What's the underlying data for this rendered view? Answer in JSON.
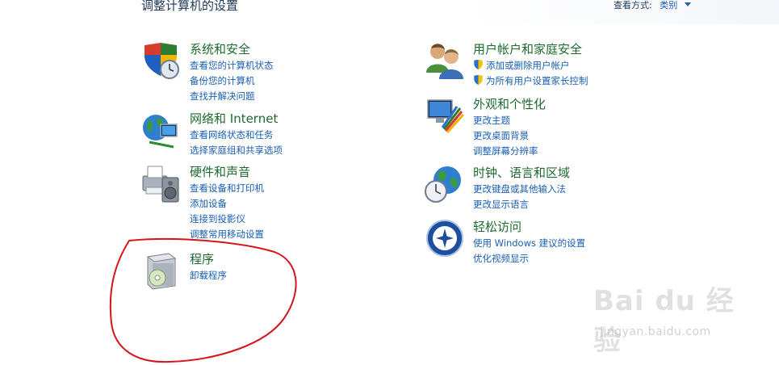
{
  "page": {
    "title": "调整计算机的设置",
    "view_by_label": "查看方式:",
    "view_by_value": "类别"
  },
  "categories": {
    "system": {
      "title": "系统和安全",
      "icon": "shield-clock-icon",
      "links": [
        "查看您的计算机状态",
        "备份您的计算机",
        "查找并解决问题"
      ]
    },
    "network": {
      "title": "网络和 Internet",
      "icon": "network-globe-icon",
      "links": [
        "查看网络状态和任务",
        "选择家庭组和共享选项"
      ]
    },
    "hardware": {
      "title": "硬件和声音",
      "icon": "printer-speaker-icon",
      "links": [
        "查看设备和打印机",
        "添加设备",
        "连接到投影仪",
        "调整常用移动设置"
      ]
    },
    "programs": {
      "title": "程序",
      "icon": "program-box-icon",
      "links": [
        "卸载程序"
      ]
    },
    "users": {
      "title": "用户帐户和家庭安全",
      "icon": "users-icon",
      "links": [
        "添加或删除用户帐户",
        "为所有用户设置家长控制"
      ]
    },
    "appearance": {
      "title": "外观和个性化",
      "icon": "monitor-palette-icon",
      "links": [
        "更改主题",
        "更改桌面背景",
        "调整屏幕分辨率"
      ]
    },
    "clock": {
      "title": "时钟、语言和区域",
      "icon": "globe-clock-icon",
      "links": [
        "更改键盘或其他输入法",
        "更改显示语言"
      ]
    },
    "ease": {
      "title": "轻松访问",
      "icon": "ease-of-access-icon",
      "links": [
        "使用 Windows 建议的设置",
        "优化视频显示"
      ]
    }
  },
  "watermark": {
    "logo_text": "Bai du 经验",
    "url": "jingyan.baidu.com"
  },
  "colors": {
    "title_green": "#1e6b2e",
    "link_blue": "#1a5fb4",
    "annotation_red": "#d4161b"
  }
}
